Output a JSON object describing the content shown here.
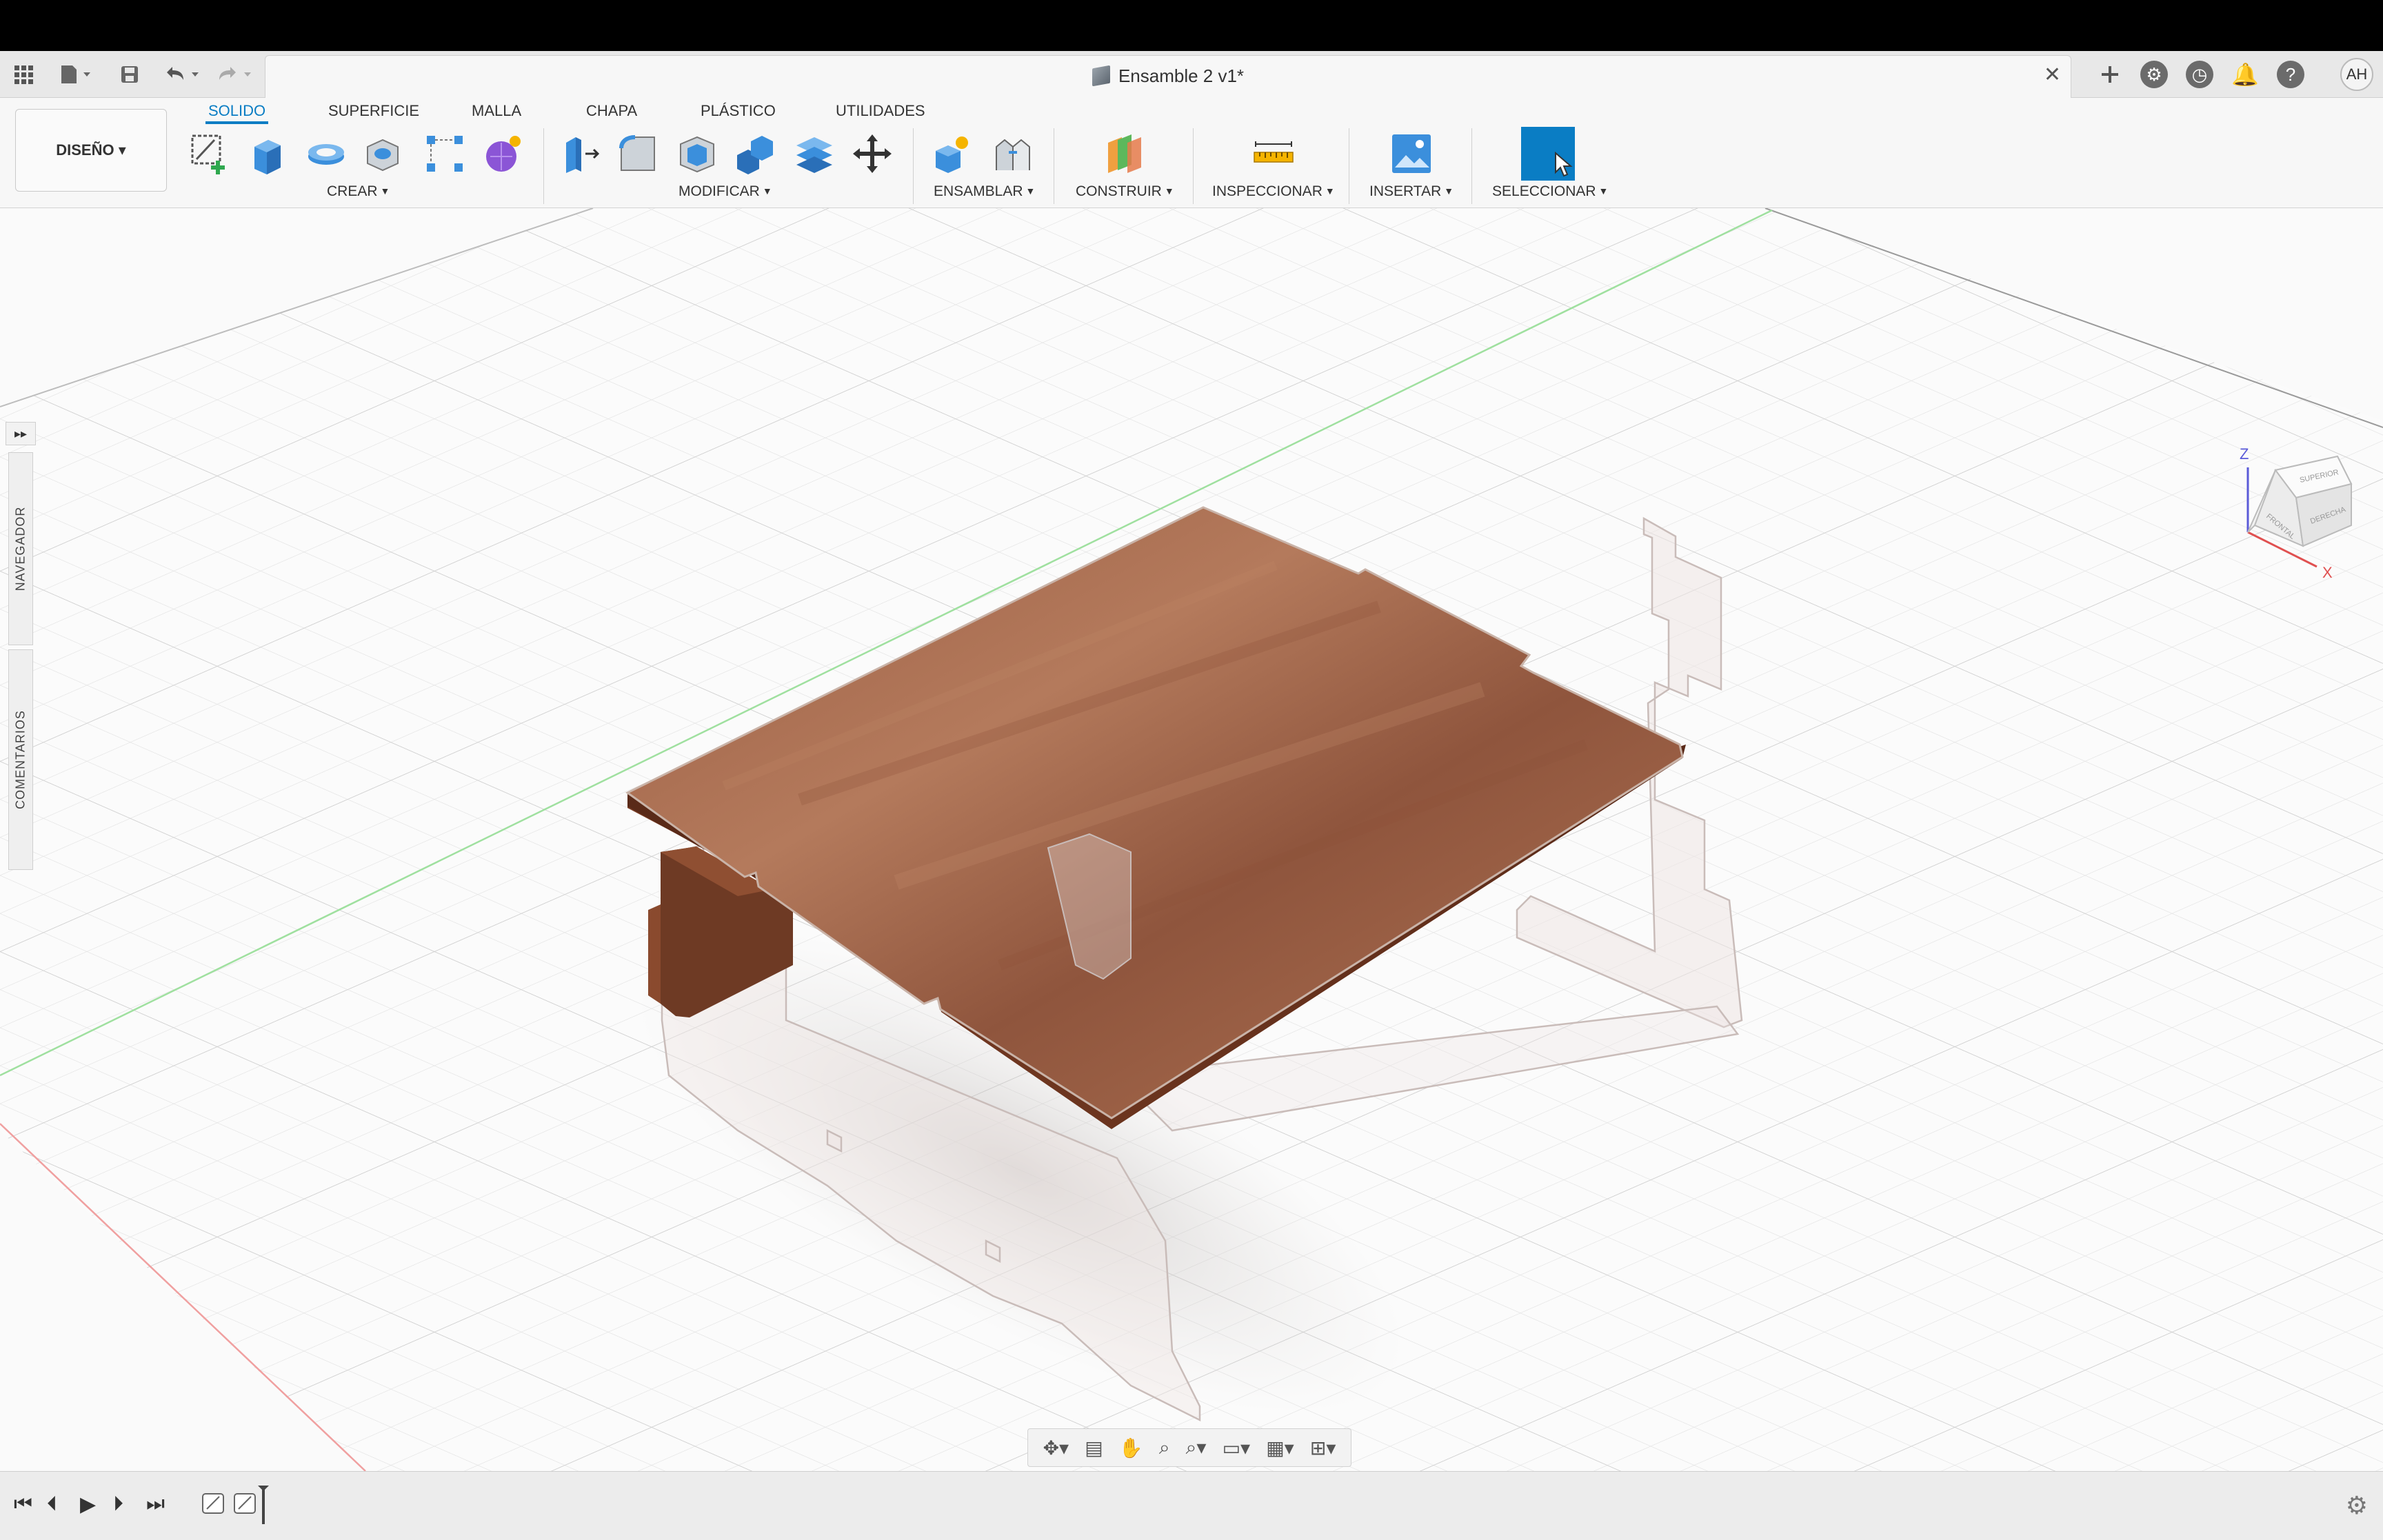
{
  "window": {
    "document_title": "Ensamble 2 v1*"
  },
  "user": {
    "initials": "AH"
  },
  "workspace": {
    "label": "DISEÑO ▾"
  },
  "tabs": [
    {
      "label": "SOLIDO",
      "active": true
    },
    {
      "label": "SUPERFICIE",
      "active": false
    },
    {
      "label": "MALLA",
      "active": false
    },
    {
      "label": "CHAPA",
      "active": false
    },
    {
      "label": "PLÁSTICO",
      "active": false
    },
    {
      "label": "UTILIDADES",
      "active": false
    }
  ],
  "groups": {
    "crear": "CREAR",
    "modificar": "MODIFICAR",
    "ensamblar": "ENSAMBLAR",
    "construir": "CONSTRUIR",
    "inspeccionar": "INSPECCIONAR",
    "insertar": "INSERTAR",
    "seleccionar": "SELECCIONAR"
  },
  "side_panel": {
    "navigator": "NAVEGADOR",
    "comments": "COMENTARIOS"
  },
  "viewcube": {
    "z_label": "Z",
    "x_label": "X",
    "top_face": "SUPERIOR",
    "front_face": "FRONTAL",
    "right_face": "DERECHA"
  },
  "colors": {
    "accent": "#0a7dc4",
    "wood": "#a86a50",
    "wood_dark": "#6e3a24",
    "x_axis": "#e07a7a",
    "y_axis": "#7ccf7c",
    "grid": "#dcdcdc"
  }
}
